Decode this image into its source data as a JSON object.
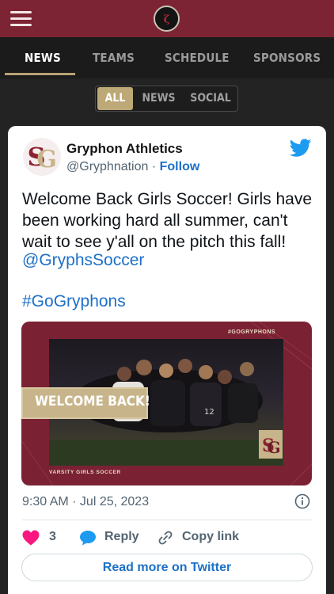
{
  "nav": {
    "tabs": [
      {
        "label": "NEWS",
        "active": true
      },
      {
        "label": "TEAMS",
        "active": false
      },
      {
        "label": "SCHEDULE",
        "active": false
      },
      {
        "label": "SPONSORS",
        "active": false
      }
    ]
  },
  "filters": [
    {
      "label": "ALL",
      "active": true
    },
    {
      "label": "NEWS",
      "active": false
    },
    {
      "label": "SOCIAL",
      "active": false
    }
  ],
  "tweet": {
    "author": "Gryphon Athletics",
    "handle": "@Gryphnation",
    "separator": " · ",
    "follow_label": "Follow",
    "text": "Welcome Back Girls Soccer! Girls have been working hard all summer, can't wait to see y'all on the pitch this fall!",
    "mention": "@GryphsSoccer",
    "hashtag": "#GoGryphons",
    "media": {
      "tag": "#GOGRYPHONS",
      "headline": "WELCOME BACK!",
      "caption": "VARSITY GIRLS SOCCER"
    },
    "timestamp": "9:30 AM · Jul 25, 2023",
    "likes": "3",
    "reply_label": "Reply",
    "copy_link_label": "Copy link",
    "read_more_label": "Read more on Twitter"
  },
  "colors": {
    "brand_maroon": "#7d2434",
    "gold_accent": "#bda977",
    "twitter_blue": "#1d9bf0",
    "link_blue": "#1d70c7",
    "heart_red": "#f91880"
  },
  "icons": [
    "hamburger-menu-icon",
    "gryphon-logo-icon",
    "twitter-bird-icon",
    "info-icon",
    "heart-icon",
    "reply-bubble-icon",
    "link-icon"
  ]
}
